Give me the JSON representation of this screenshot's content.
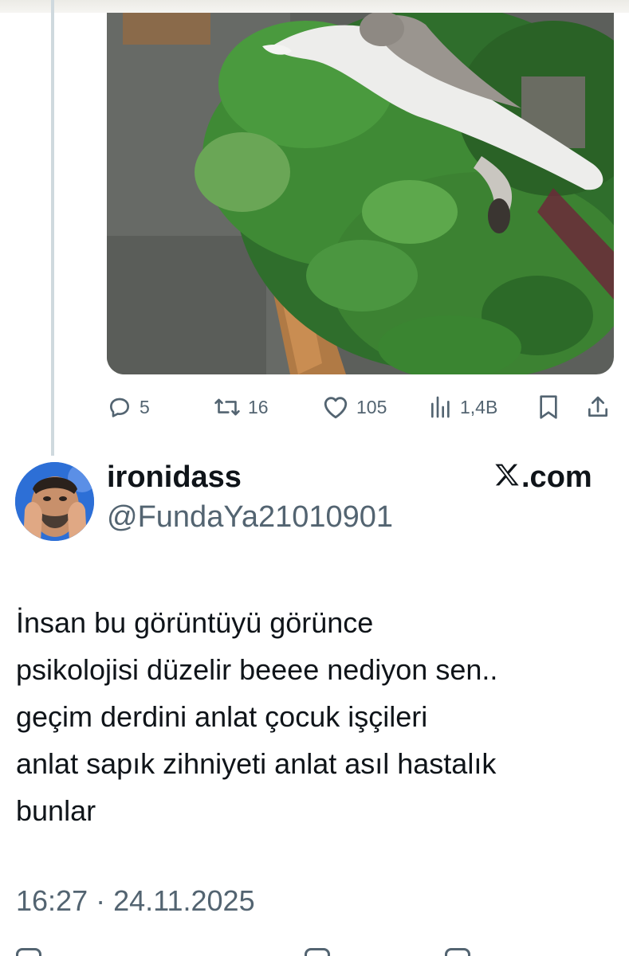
{
  "quoted_tweet": {
    "image_icon": "photo-cat-on-greens",
    "reply_count": "5",
    "retweet_count": "16",
    "like_count": "105",
    "view_count": "1,4B",
    "icons": {
      "reply": "reply-icon",
      "retweet": "retweet-icon",
      "like": "heart-icon",
      "views": "views-icon",
      "bookmark": "bookmark-icon",
      "share": "share-icon"
    }
  },
  "tweet": {
    "display_name": "ironidass",
    "handle": "@FundaYa21010901",
    "source_label": ".com",
    "source_icon": "x-logo-icon",
    "text_lines": [
      "İnsan bu görüntüyü görünce",
      "psikolojisi düzelir beeee nediyon sen..",
      "geçim derdini anlat çocuk işçileri",
      "anlat sapık zihniyeti anlat asıl hastalık",
      "bunlar"
    ],
    "timestamp": "16:27 · 24.11.2025"
  },
  "colors": {
    "text_primary": "#0f1419",
    "text_secondary": "#536471",
    "thread_line": "#cfd9de",
    "avatar_bg": "#2d6fd6"
  }
}
